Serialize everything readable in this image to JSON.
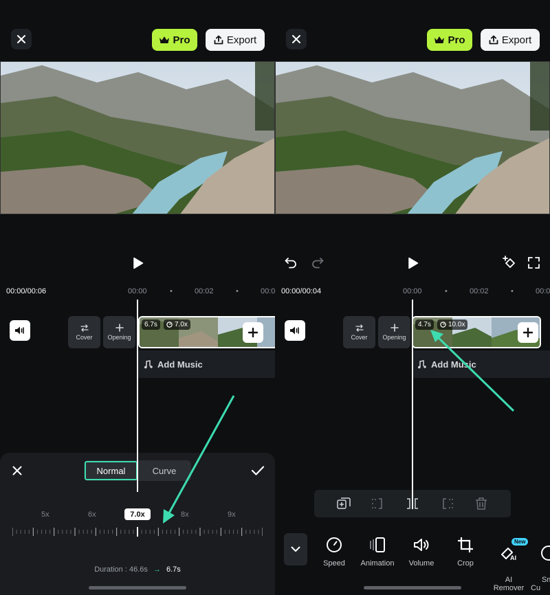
{
  "common": {
    "pro_label": "Pro",
    "export_label": "Export",
    "add_music_label": "Add Music",
    "cover_label": "Cover",
    "opening_label": "Opening"
  },
  "left": {
    "time_display": "00:00/00:06",
    "ruler_labels": [
      "00:00",
      "00:02",
      "00:0"
    ],
    "clip_duration": "6.7s",
    "clip_speed": "7.0x",
    "speed_panel": {
      "tabs": [
        "Normal",
        "Curve"
      ],
      "active_tab": "Normal",
      "scale_labels": [
        "5x",
        "6x",
        "8x",
        "9x"
      ],
      "current_speed": "7.0x",
      "speed_value": 7.0,
      "duration_prefix": "Duration : 46.6s",
      "duration_arrow": "→",
      "duration_new": "6.7s"
    }
  },
  "right": {
    "time_display": "00:00/00:04",
    "ruler_labels": [
      "00:00",
      "00:02",
      "00:0"
    ],
    "clip_duration": "4.7s",
    "clip_speed": "10.0x",
    "tools": [
      {
        "label": "Speed",
        "icon": "speed-icon"
      },
      {
        "label": "Animation",
        "icon": "animation-icon"
      },
      {
        "label": "Volume",
        "icon": "volume-icon"
      },
      {
        "label": "Crop",
        "icon": "crop-icon"
      },
      {
        "label": "AI\nRemover",
        "icon": "ai-remover-icon",
        "badge": "New"
      },
      {
        "label": "Sm\nCu",
        "icon": "smart-cut-icon"
      }
    ]
  },
  "colors": {
    "accent_pro": "#b6f23d",
    "highlight": "#3ddbb0",
    "background": "#0d0f11",
    "badge_new": "#41d2ff"
  }
}
